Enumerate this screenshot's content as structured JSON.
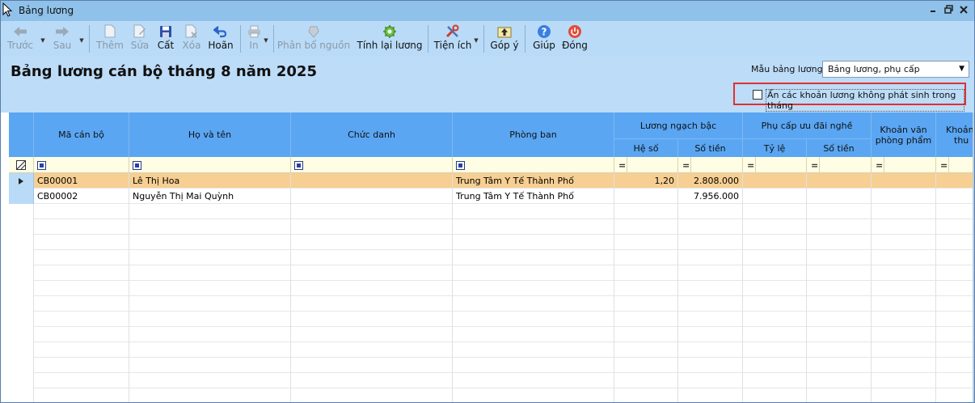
{
  "window": {
    "title": "Bảng lương",
    "controls": [
      "restore",
      "maximize",
      "close"
    ]
  },
  "toolbar": {
    "prev": "Trước",
    "next": "Sau",
    "add": "Thêm",
    "edit": "Sửa",
    "save": "Cất",
    "delete": "Xóa",
    "undo": "Hoãn",
    "print": "In",
    "allocate": "Phân bổ nguồn",
    "recalc": "Tính lại lương",
    "utilities": "Tiện ích",
    "feedback": "Góp ý",
    "help": "Giúp",
    "close": "Đóng"
  },
  "header": {
    "title": "Bảng lương cán bộ tháng 8 năm 2025",
    "template_label": "Mẫu bảng lương",
    "template_value": "Bảng lương, phụ cấp",
    "hide_checkbox_label": "Ẩn các khoản lương không phát sinh trong tháng",
    "hide_checkbox_checked": false
  },
  "grid": {
    "columns": {
      "code": "Mã cán bộ",
      "name": "Họ và tên",
      "title": "Chức danh",
      "dept": "Phòng ban",
      "salary_group": "Lương ngạch bậc",
      "coef": "Hệ số",
      "amount": "Số tiền",
      "allow_group": "Phụ cấp ưu đãi nghề",
      "rate": "Tỷ lệ",
      "allow_amount": "Số tiền",
      "stationery_line1": "Khoản văn",
      "stationery_line2": "phòng phẩm",
      "more_line1": "Khoản",
      "more_line2": "thu"
    },
    "filter_eq": "=",
    "rows": [
      {
        "code": "CB00001",
        "name": "Lê Thị Hoa",
        "title": "",
        "dept": "Trung Tâm Y Tế Thành Phố",
        "coef": "1,20",
        "amount": "2.808.000",
        "selected": true
      },
      {
        "code": "CB00002",
        "name": "Nguyễn Thị Mai Quỳnh",
        "title": "",
        "dept": "Trung Tâm Y Tế Thành Phố",
        "coef": "",
        "amount": "7.956.000",
        "selected": false
      }
    ]
  }
}
